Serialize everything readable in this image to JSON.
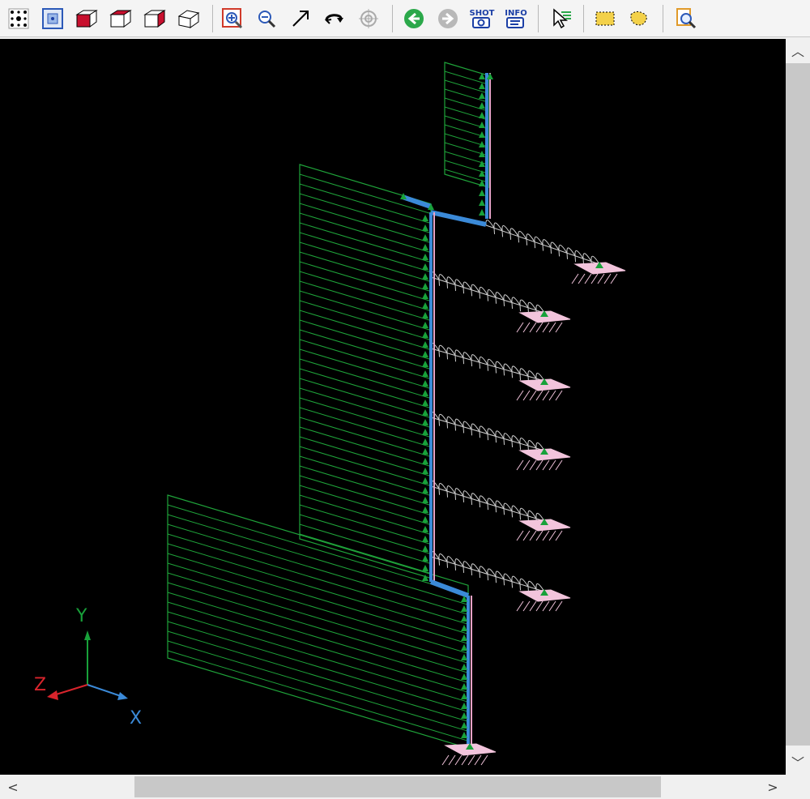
{
  "toolbar": {
    "shot_label": "SHOT",
    "info_label": "INFO",
    "buttons": [
      {
        "icon": "snap-points-icon"
      },
      {
        "icon": "select-grid-icon"
      },
      {
        "icon": "view-front-icon"
      },
      {
        "icon": "view-top-icon"
      },
      {
        "icon": "view-side-icon"
      },
      {
        "icon": "view-iso-icon"
      },
      {
        "icon": "zoom-window-icon"
      },
      {
        "icon": "zoom-out-icon"
      },
      {
        "icon": "pan-arrow-icon"
      },
      {
        "icon": "rotate-icon"
      },
      {
        "icon": "center-target-icon"
      },
      {
        "icon": "back-green-icon"
      },
      {
        "icon": "forward-gray-icon"
      },
      {
        "icon": "shot-icon"
      },
      {
        "icon": "info-icon"
      },
      {
        "icon": "select-pointer-icon"
      },
      {
        "icon": "select-box-icon"
      },
      {
        "icon": "select-lasso-icon"
      },
      {
        "icon": "find-search-icon"
      }
    ]
  },
  "axes": {
    "x": "X",
    "y": "Y",
    "z": "Z"
  },
  "colors": {
    "viewport_bg": "#000000",
    "load_hatch": "#1fa33a",
    "member_blue": "#3b8ad8",
    "member_pink": "#e8a4c8",
    "spring": "#d0d0d0",
    "support": "#f2c4dc",
    "axis_x": "#3b8ad8",
    "axis_y": "#18a13a",
    "axis_z": "#d8242c"
  },
  "scrollbars": {
    "vertical_up": "︿",
    "vertical_down": "﹀",
    "horizontal_left": "<",
    "horizontal_right": ">"
  }
}
